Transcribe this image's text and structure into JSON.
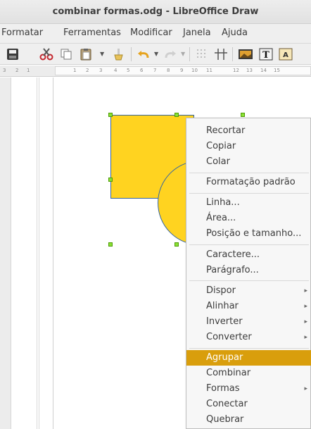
{
  "window": {
    "title": "combinar formas.odg - LibreOffice Draw"
  },
  "menubar": {
    "items": [
      "Formatar",
      "Ferramentas",
      "Modificar",
      "Janela",
      "Ajuda"
    ]
  },
  "toolbar": {
    "icons": [
      "save-icon",
      "cut-icon",
      "copy-icon",
      "paste-icon",
      "dropdown-arrow-icon",
      "clone-formatting-icon",
      "undo-icon",
      "dropdown-arrow-icon",
      "redo-icon",
      "dropdown-arrow-icon",
      "grid-icon",
      "helplines-icon",
      "image-icon",
      "textbox-icon",
      "fontwork-icon"
    ]
  },
  "ruler": {
    "left_labels": [
      "3",
      "2",
      "1"
    ],
    "labels": [
      "1",
      "2",
      "3",
      "4",
      "5",
      "6",
      "7",
      "8",
      "9",
      "10",
      "11",
      "12",
      "13",
      "14",
      "15"
    ]
  },
  "canvas": {
    "shape_fill": "#ffd320",
    "shape_border": "#3465a4",
    "handle_color": "#8ae234"
  },
  "context_menu": {
    "highlight_color": "#d99e0c",
    "groups": [
      [
        "Recortar",
        "Copiar",
        "Colar"
      ],
      [
        "Formatação padrão"
      ],
      [
        "Linha...",
        "Área...",
        "Posição e tamanho..."
      ],
      [
        "Caractere...",
        "Parágrafo..."
      ],
      [
        "Dispor",
        "Alinhar",
        "Inverter",
        "Converter"
      ],
      [
        "Agrupar",
        "Combinar",
        "Formas",
        "Conectar",
        "Quebrar"
      ]
    ],
    "items": {
      "recortar": "Recortar",
      "copiar": "Copiar",
      "colar": "Colar",
      "formatacao_padrao": "Formatação padrão",
      "linha": "Linha...",
      "area": "Área...",
      "posicao_tamanho": "Posição e tamanho...",
      "caractere": "Caractere...",
      "paragrafo": "Parágrafo...",
      "dispor": "Dispor",
      "alinhar": "Alinhar",
      "inverter": "Inverter",
      "converter": "Converter",
      "agrupar": "Agrupar",
      "combinar": "Combinar",
      "formas": "Formas",
      "conectar": "Conectar",
      "quebrar": "Quebrar"
    },
    "submenu_arrow": "▸",
    "active_item": "Agrupar"
  }
}
